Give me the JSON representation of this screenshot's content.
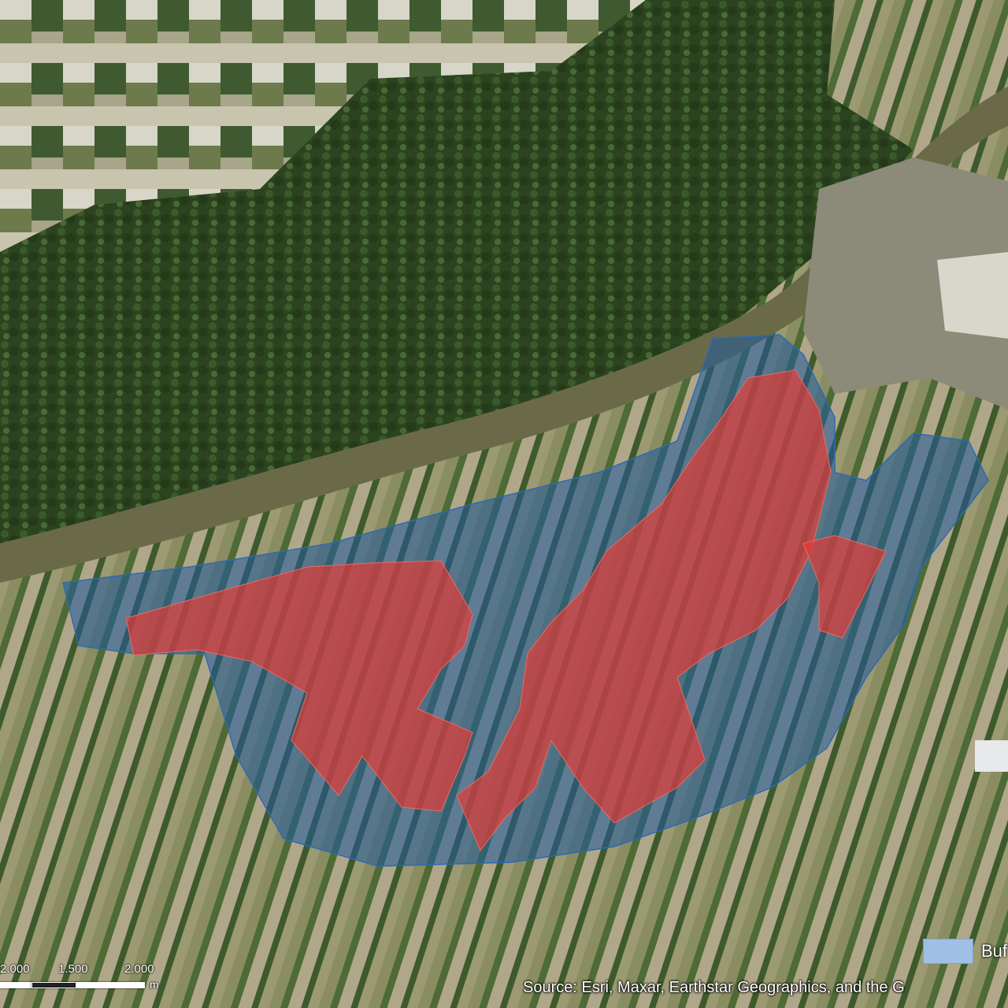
{
  "legend": {
    "label": "Buf",
    "swatch_color": "#9fbfe6"
  },
  "scale": {
    "ticks": [
      "2.000",
      "1.500",
      "2.000"
    ],
    "unit": "m"
  },
  "attribution": "Source: Esri, Maxar, Earthstar Geographics, and the G",
  "colors": {
    "buffer_fill": "#1f5a9e",
    "parcel_fill": "#e23b35",
    "river": "#6b6a48",
    "forest": "#2f4522"
  },
  "icons": [
    "satellite-basemap",
    "scale-bar"
  ]
}
